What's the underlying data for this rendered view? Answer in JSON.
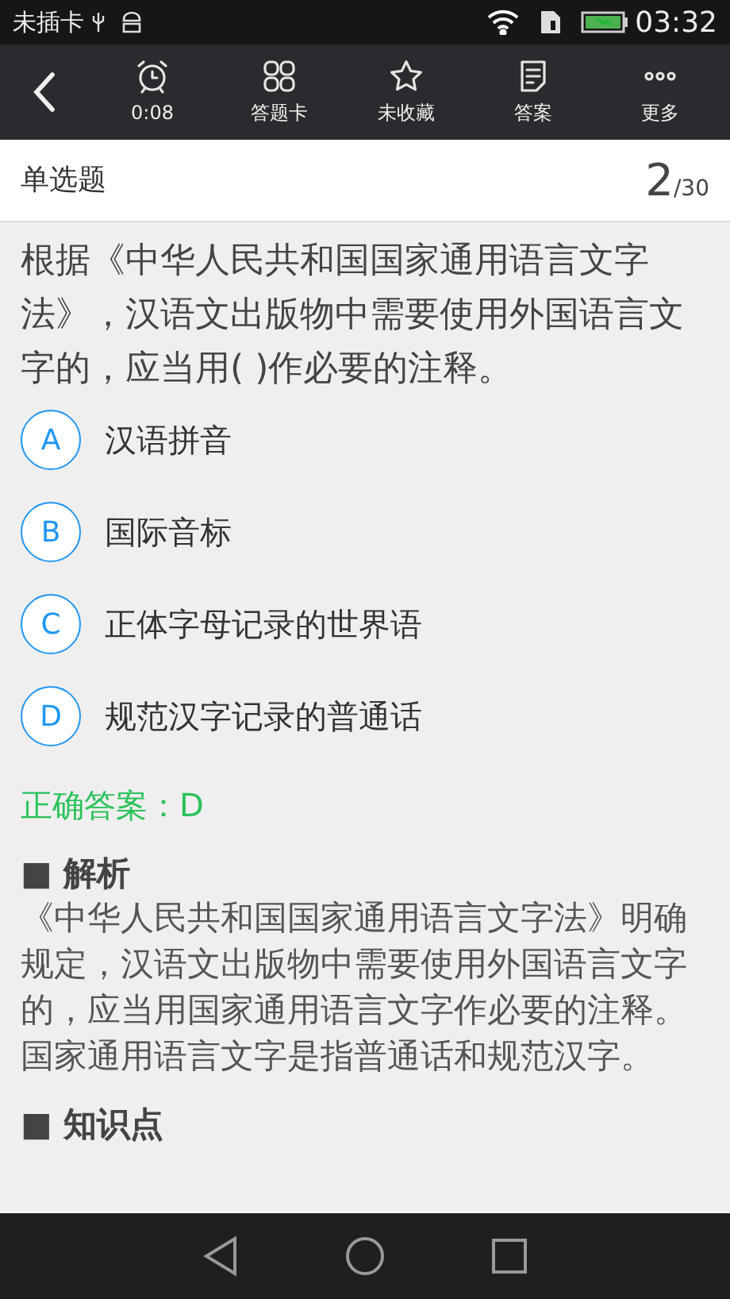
{
  "status_bar": {
    "carrier": "未插卡",
    "time": "03:32"
  },
  "toolbar": {
    "items": [
      {
        "kind": "timer",
        "label": "0:08"
      },
      {
        "kind": "card",
        "label": "答题卡"
      },
      {
        "kind": "star",
        "label": "未收藏"
      },
      {
        "kind": "answer",
        "label": "答案"
      },
      {
        "kind": "more",
        "label": "更多"
      }
    ]
  },
  "header": {
    "type": "单选题",
    "current": "2",
    "total": "/30"
  },
  "question": "根据《中华人民共和国国家通用语言文字法》，汉语文出版物中需要使用外国语言文字的，应当用(   )作必要的注释。",
  "options": [
    {
      "letter": "A",
      "text": "汉语拼音"
    },
    {
      "letter": "B",
      "text": "国际音标"
    },
    {
      "letter": "C",
      "text": "正体字母记录的世界语"
    },
    {
      "letter": "D",
      "text": "规范汉字记录的普通话"
    }
  ],
  "correct_answer": "正确答案：D",
  "sections": [
    {
      "bullet": "■",
      "title": "解析",
      "body": "《中华人民共和国国家通用语言文字法》明确规定，汉语文出版物中需要使用外国语言文字的，应当用国家通用语言文字作必要的注释。国家通用语言文字是指普通话和规范汉字。"
    },
    {
      "bullet": "■",
      "title": "知识点"
    }
  ]
}
